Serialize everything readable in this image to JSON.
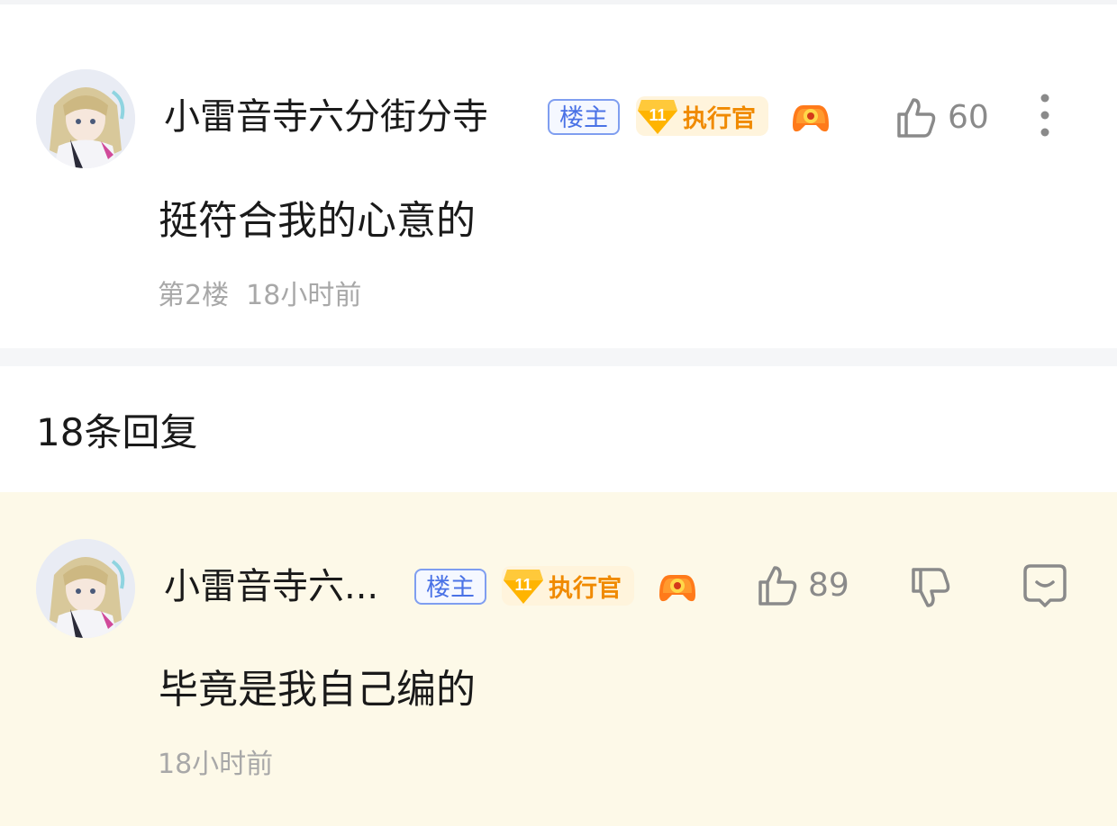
{
  "main_post": {
    "author": "小雷音寺六分街分寺",
    "owner_tag": "楼主",
    "level": "11",
    "title_badge": "执行官",
    "like_count": "60",
    "content": "挺符合我的心意的",
    "floor": "第2楼",
    "time": "18小时前"
  },
  "replies_header": {
    "count_label": "18条回复"
  },
  "reply": {
    "author": "小雷音寺六...",
    "owner_tag": "楼主",
    "level": "11",
    "title_badge": "执行官",
    "like_count": "89",
    "content": "毕竟是我自己编的",
    "time": "18小时前"
  },
  "colors": {
    "owner_tag": "#4a72e6",
    "title_badge": "#f08a00",
    "reply_background": "#fdf9e8",
    "meta_text": "#a8a8a8"
  },
  "icons": [
    "avatar",
    "level-diamond-icon",
    "game-controller-icon",
    "thumbs-up-icon",
    "more-vertical-icon",
    "thumbs-down-icon",
    "comment-icon"
  ]
}
